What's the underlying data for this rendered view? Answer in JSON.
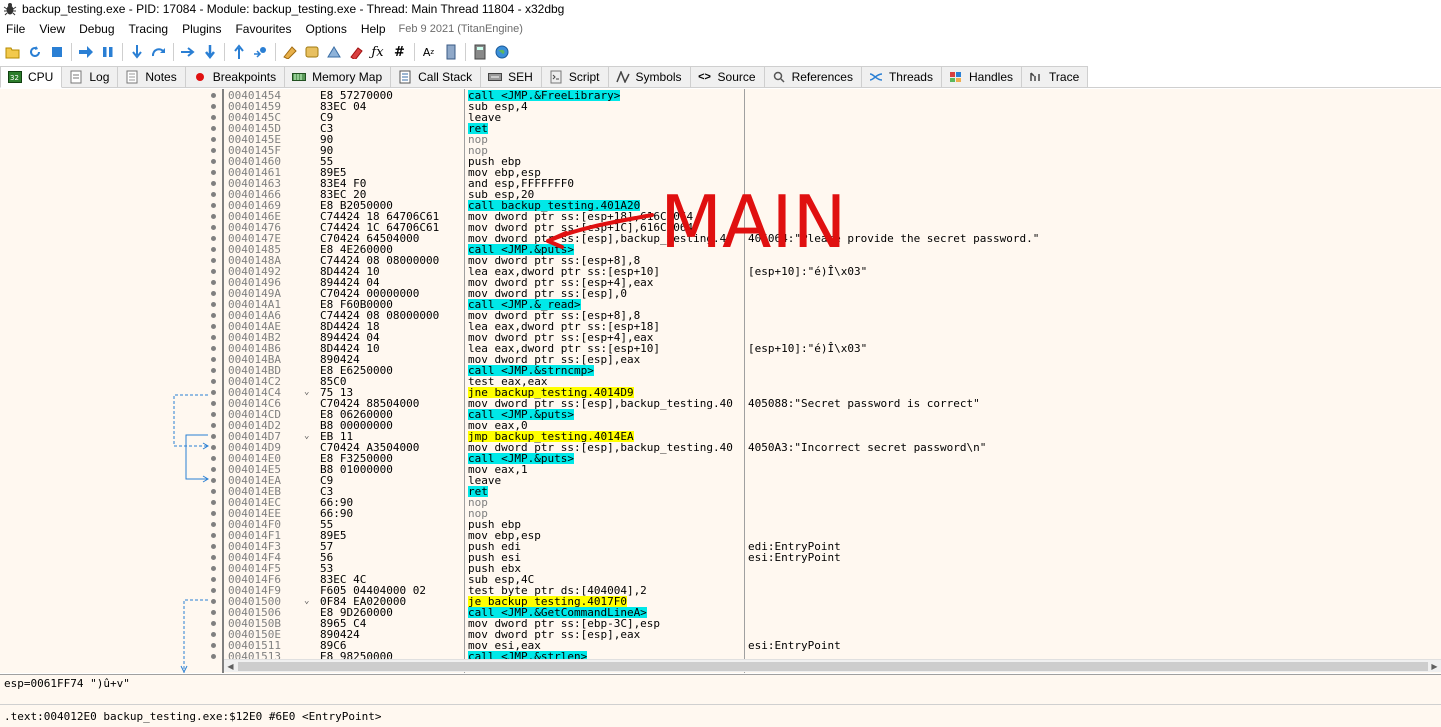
{
  "window": {
    "title": "backup_testing.exe - PID: 17084 - Module: backup_testing.exe - Thread: Main Thread 11804 - x32dbg"
  },
  "menu": {
    "items": [
      "File",
      "View",
      "Debug",
      "Tracing",
      "Plugins",
      "Favourites",
      "Options",
      "Help"
    ],
    "build_info": "Feb 9 2021 (TitanEngine)"
  },
  "tabs": [
    {
      "label": "CPU",
      "icon": "cpu-icon"
    },
    {
      "label": "Log",
      "icon": "log-icon"
    },
    {
      "label": "Notes",
      "icon": "notes-icon"
    },
    {
      "label": "Breakpoints",
      "icon": "breakpoint-icon"
    },
    {
      "label": "Memory Map",
      "icon": "memory-map-icon"
    },
    {
      "label": "Call Stack",
      "icon": "call-stack-icon"
    },
    {
      "label": "SEH",
      "icon": "seh-icon"
    },
    {
      "label": "Script",
      "icon": "script-icon"
    },
    {
      "label": "Symbols",
      "icon": "symbols-icon"
    },
    {
      "label": "Source",
      "icon": "source-icon"
    },
    {
      "label": "References",
      "icon": "references-icon"
    },
    {
      "label": "Threads",
      "icon": "threads-icon"
    },
    {
      "label": "Handles",
      "icon": "handles-icon"
    },
    {
      "label": "Trace",
      "icon": "trace-icon"
    }
  ],
  "disasm": [
    {
      "addr": "00401454",
      "bytes": "E8 57270000",
      "instr": "call <JMP.&FreeLibrary>",
      "kind": "call",
      "cmt": ""
    },
    {
      "addr": "00401459",
      "bytes": "83EC 04",
      "instr": "sub esp,4",
      "kind": "",
      "cmt": ""
    },
    {
      "addr": "0040145C",
      "bytes": "C9",
      "instr": "leave",
      "kind": "",
      "cmt": ""
    },
    {
      "addr": "0040145D",
      "bytes": "C3",
      "instr": "ret",
      "kind": "ret",
      "cmt": ""
    },
    {
      "addr": "0040145E",
      "bytes": "90",
      "instr": "nop",
      "kind": "nop",
      "cmt": ""
    },
    {
      "addr": "0040145F",
      "bytes": "90",
      "instr": "nop",
      "kind": "nop",
      "cmt": ""
    },
    {
      "addr": "00401460",
      "bytes": "55",
      "instr": "push ebp",
      "kind": "",
      "cmt": ""
    },
    {
      "addr": "00401461",
      "bytes": "89E5",
      "instr": "mov ebp,esp",
      "kind": "",
      "cmt": ""
    },
    {
      "addr": "00401463",
      "bytes": "83E4 F0",
      "instr": "and esp,FFFFFFF0",
      "kind": "",
      "cmt": ""
    },
    {
      "addr": "00401466",
      "bytes": "83EC 20",
      "instr": "sub esp,20",
      "kind": "",
      "cmt": ""
    },
    {
      "addr": "00401469",
      "bytes": "E8 B2050000",
      "instr": "call backup_testing.401A20",
      "kind": "call",
      "cmt": ""
    },
    {
      "addr": "0040146E",
      "bytes": "C74424 18 64706C61",
      "instr": "mov dword ptr ss:[esp+18],616C7064",
      "kind": "",
      "cmt": ""
    },
    {
      "addr": "00401476",
      "bytes": "C74424 1C 64706C61",
      "instr": "mov dword ptr ss:[esp+1C],616C7064",
      "kind": "",
      "cmt": ""
    },
    {
      "addr": "0040147E",
      "bytes": "C70424 64504000",
      "instr": "mov dword ptr ss:[esp],backup_testing.40",
      "kind": "",
      "cmt": "405064:\"Please provide the secret password.\""
    },
    {
      "addr": "00401485",
      "bytes": "E8 4E260000",
      "instr": "call <JMP.&puts>",
      "kind": "call",
      "cmt": ""
    },
    {
      "addr": "0040148A",
      "bytes": "C74424 08 08000000",
      "instr": "mov dword ptr ss:[esp+8],8",
      "kind": "",
      "cmt": ""
    },
    {
      "addr": "00401492",
      "bytes": "8D4424 10",
      "instr": "lea eax,dword ptr ss:[esp+10]",
      "kind": "",
      "cmt": "[esp+10]:\"é)Î\\x03\""
    },
    {
      "addr": "00401496",
      "bytes": "894424 04",
      "instr": "mov dword ptr ss:[esp+4],eax",
      "kind": "",
      "cmt": ""
    },
    {
      "addr": "0040149A",
      "bytes": "C70424 00000000",
      "instr": "mov dword ptr ss:[esp],0",
      "kind": "",
      "cmt": ""
    },
    {
      "addr": "004014A1",
      "bytes": "E8 F60B0000",
      "instr": "call <JMP.&_read>",
      "kind": "call",
      "cmt": ""
    },
    {
      "addr": "004014A6",
      "bytes": "C74424 08 08000000",
      "instr": "mov dword ptr ss:[esp+8],8",
      "kind": "",
      "cmt": ""
    },
    {
      "addr": "004014AE",
      "bytes": "8D4424 18",
      "instr": "lea eax,dword ptr ss:[esp+18]",
      "kind": "",
      "cmt": ""
    },
    {
      "addr": "004014B2",
      "bytes": "894424 04",
      "instr": "mov dword ptr ss:[esp+4],eax",
      "kind": "",
      "cmt": ""
    },
    {
      "addr": "004014B6",
      "bytes": "8D4424 10",
      "instr": "lea eax,dword ptr ss:[esp+10]",
      "kind": "",
      "cmt": "[esp+10]:\"é)Î\\x03\""
    },
    {
      "addr": "004014BA",
      "bytes": "890424",
      "instr": "mov dword ptr ss:[esp],eax",
      "kind": "",
      "cmt": ""
    },
    {
      "addr": "004014BD",
      "bytes": "E8 E6250000",
      "instr": "call <JMP.&strncmp>",
      "kind": "call",
      "cmt": ""
    },
    {
      "addr": "004014C2",
      "bytes": "85C0",
      "instr": "test eax,eax",
      "kind": "",
      "cmt": ""
    },
    {
      "addr": "004014C4",
      "bytes": "75 13",
      "instr": "jne backup_testing.4014D9",
      "kind": "jcc",
      "cmt": ""
    },
    {
      "addr": "004014C6",
      "bytes": "C70424 88504000",
      "instr": "mov dword ptr ss:[esp],backup_testing.40",
      "kind": "",
      "cmt": "405088:\"Secret password is correct\""
    },
    {
      "addr": "004014CD",
      "bytes": "E8 06260000",
      "instr": "call <JMP.&puts>",
      "kind": "call",
      "cmt": ""
    },
    {
      "addr": "004014D2",
      "bytes": "B8 00000000",
      "instr": "mov eax,0",
      "kind": "",
      "cmt": ""
    },
    {
      "addr": "004014D7",
      "bytes": "EB 11",
      "instr": "jmp backup_testing.4014EA",
      "kind": "jcc",
      "cmt": ""
    },
    {
      "addr": "004014D9",
      "bytes": "C70424 A3504000",
      "instr": "mov dword ptr ss:[esp],backup_testing.40",
      "kind": "",
      "cmt": "4050A3:\"Incorrect secret password\\n\""
    },
    {
      "addr": "004014E0",
      "bytes": "E8 F3250000",
      "instr": "call <JMP.&puts>",
      "kind": "call",
      "cmt": ""
    },
    {
      "addr": "004014E5",
      "bytes": "B8 01000000",
      "instr": "mov eax,1",
      "kind": "",
      "cmt": ""
    },
    {
      "addr": "004014EA",
      "bytes": "C9",
      "instr": "leave",
      "kind": "",
      "cmt": ""
    },
    {
      "addr": "004014EB",
      "bytes": "C3",
      "instr": "ret",
      "kind": "ret",
      "cmt": ""
    },
    {
      "addr": "004014EC",
      "bytes": "66:90",
      "instr": "nop",
      "kind": "nop",
      "cmt": ""
    },
    {
      "addr": "004014EE",
      "bytes": "66:90",
      "instr": "nop",
      "kind": "nop",
      "cmt": ""
    },
    {
      "addr": "004014F0",
      "bytes": "55",
      "instr": "push ebp",
      "kind": "",
      "cmt": ""
    },
    {
      "addr": "004014F1",
      "bytes": "89E5",
      "instr": "mov ebp,esp",
      "kind": "",
      "cmt": ""
    },
    {
      "addr": "004014F3",
      "bytes": "57",
      "instr": "push edi",
      "kind": "",
      "cmt": "edi:EntryPoint"
    },
    {
      "addr": "004014F4",
      "bytes": "56",
      "instr": "push esi",
      "kind": "",
      "cmt": "esi:EntryPoint"
    },
    {
      "addr": "004014F5",
      "bytes": "53",
      "instr": "push ebx",
      "kind": "",
      "cmt": ""
    },
    {
      "addr": "004014F6",
      "bytes": "83EC 4C",
      "instr": "sub esp,4C",
      "kind": "",
      "cmt": ""
    },
    {
      "addr": "004014F9",
      "bytes": "F605 04404000 02",
      "instr": "test byte ptr ds:[404004],2",
      "kind": "",
      "cmt": ""
    },
    {
      "addr": "00401500",
      "bytes": "0F84 EA020000",
      "instr": "je backup_testing.4017F0",
      "kind": "jcc",
      "cmt": ""
    },
    {
      "addr": "00401506",
      "bytes": "E8 9D260000",
      "instr": "call <JMP.&GetCommandLineA>",
      "kind": "call",
      "cmt": ""
    },
    {
      "addr": "0040150B",
      "bytes": "8965 C4",
      "instr": "mov dword ptr ss:[ebp-3C],esp",
      "kind": "",
      "cmt": ""
    },
    {
      "addr": "0040150E",
      "bytes": "890424",
      "instr": "mov dword ptr ss:[esp],eax",
      "kind": "",
      "cmt": ""
    },
    {
      "addr": "00401511",
      "bytes": "89C6",
      "instr": "mov esi,eax",
      "kind": "",
      "cmt": "esi:EntryPoint"
    },
    {
      "addr": "00401513",
      "bytes": "E8 98250000",
      "instr": "call <JMP.&strlen>",
      "kind": "call",
      "cmt": ""
    }
  ],
  "info_line": "esp=0061FF74 \")û+v\"",
  "status_line": ".text:004012E0 backup_testing.exe:$12E0 #6E0 <EntryPoint>",
  "annotation": "MAIN",
  "colors": {
    "call_bg": "#00e8e8",
    "jump_bg": "#ffff00",
    "disasm_bg": "#fff8f0",
    "annotation": "#e01010"
  }
}
